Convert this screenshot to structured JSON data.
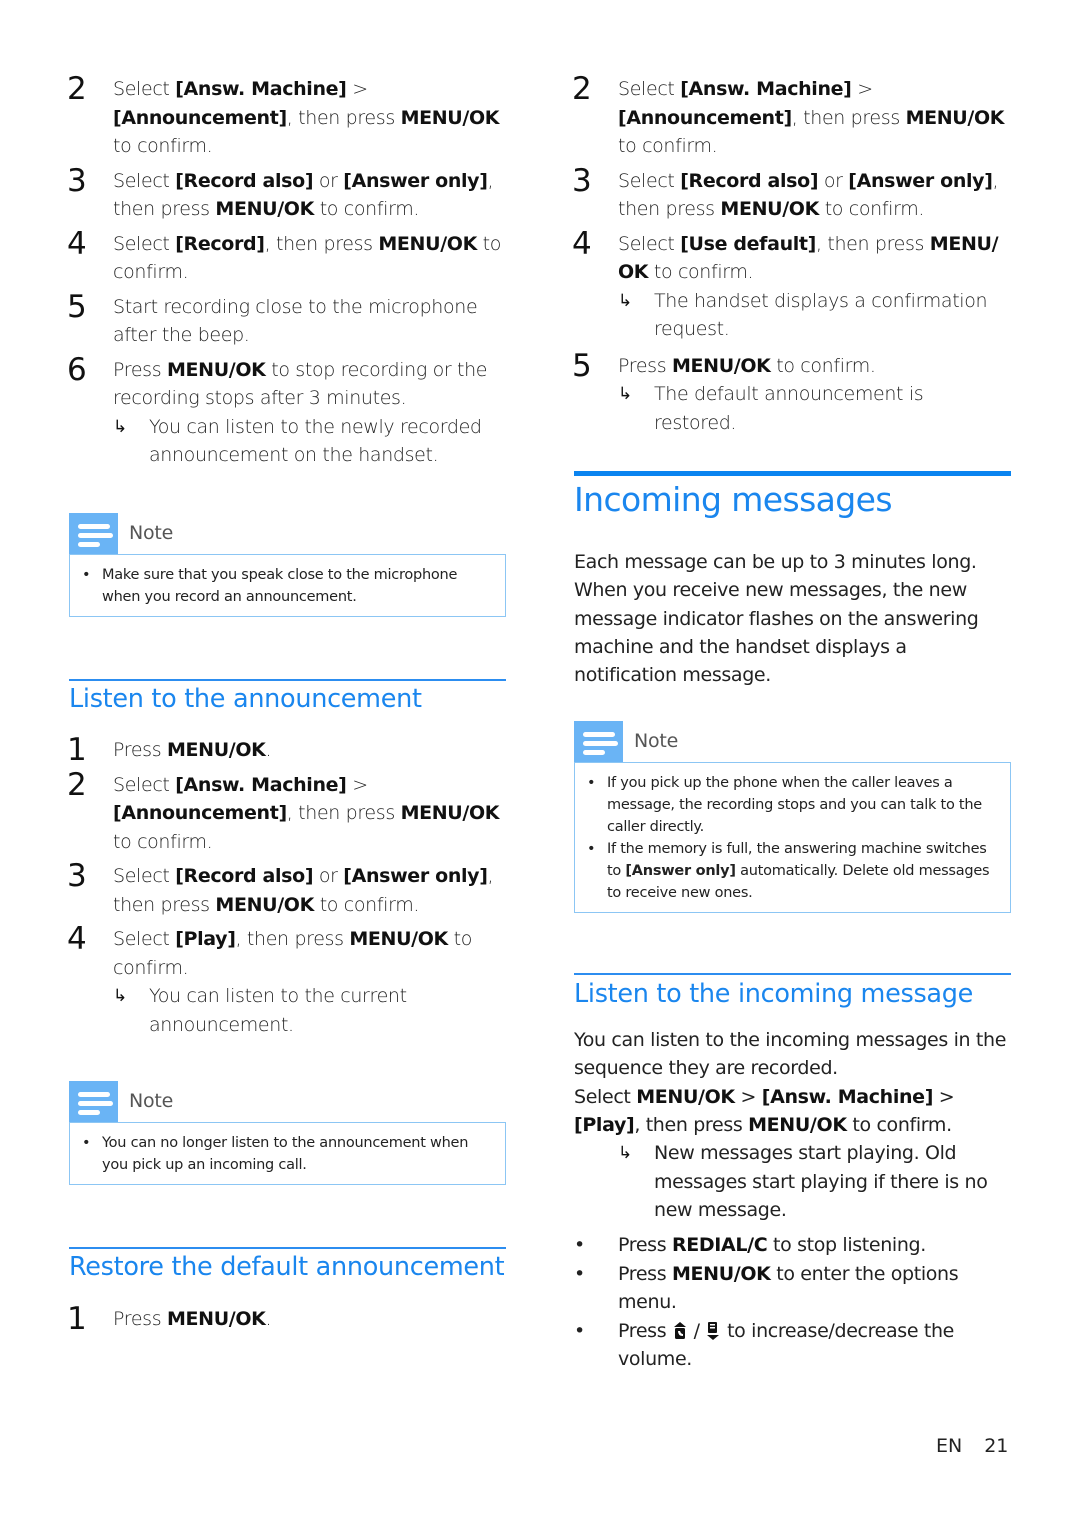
{
  "accent_color": "#1a86ee",
  "note_color": "#6ab4f5",
  "left": {
    "record_steps": [
      {
        "num": "2",
        "parts": [
          [
            "t",
            "Select "
          ],
          [
            "b",
            "[Answ. Machine]"
          ],
          [
            "t",
            " > "
          ],
          [
            "b",
            "[Announcement]"
          ],
          [
            "t",
            ", then press "
          ],
          [
            "b",
            "MENU/OK"
          ],
          [
            "t",
            " to confirm."
          ]
        ]
      },
      {
        "num": "3",
        "parts": [
          [
            "t",
            "Select "
          ],
          [
            "b",
            "[Record also]"
          ],
          [
            "t",
            " or "
          ],
          [
            "b",
            "[Answer only]"
          ],
          [
            "t",
            ", then press "
          ],
          [
            "b",
            "MENU/OK"
          ],
          [
            "t",
            " to confirm."
          ]
        ]
      },
      {
        "num": "4",
        "parts": [
          [
            "t",
            "Select "
          ],
          [
            "b",
            "[Record]"
          ],
          [
            "t",
            ", then press "
          ],
          [
            "b",
            "MENU/OK"
          ],
          [
            "t",
            " to confirm."
          ]
        ]
      },
      {
        "num": "5",
        "parts": [
          [
            "t",
            "Start recording close to the microphone after the beep."
          ]
        ]
      },
      {
        "num": "6",
        "parts": [
          [
            "t",
            "Press "
          ],
          [
            "b",
            "MENU/OK"
          ],
          [
            "t",
            " to stop recording or the recording stops after 3 minutes."
          ]
        ],
        "result": "You can listen to the newly recorded announcement on the handset."
      }
    ],
    "note1": {
      "label": "Note",
      "items": [
        [
          [
            "t",
            "Make sure that you speak close to the microphone when you record an announcement."
          ]
        ]
      ]
    },
    "listen_heading": "Listen to the announcement",
    "listen_steps": [
      {
        "num": "1",
        "parts": [
          [
            "t",
            "Press "
          ],
          [
            "b",
            "MENU/OK"
          ],
          [
            "t",
            "."
          ]
        ]
      },
      {
        "num": "2",
        "parts": [
          [
            "t",
            "Select "
          ],
          [
            "b",
            "[Answ. Machine]"
          ],
          [
            "t",
            " > "
          ],
          [
            "b",
            "[Announcement]"
          ],
          [
            "t",
            ", then press "
          ],
          [
            "b",
            "MENU/OK"
          ],
          [
            "t",
            " to confirm."
          ]
        ]
      },
      {
        "num": "3",
        "parts": [
          [
            "t",
            "Select "
          ],
          [
            "b",
            "[Record also]"
          ],
          [
            "t",
            " or "
          ],
          [
            "b",
            "[Answer only]"
          ],
          [
            "t",
            ", then press "
          ],
          [
            "b",
            "MENU/OK"
          ],
          [
            "t",
            " to confirm."
          ]
        ]
      },
      {
        "num": "4",
        "parts": [
          [
            "t",
            "Select "
          ],
          [
            "b",
            "[Play]"
          ],
          [
            "t",
            ", then press "
          ],
          [
            "b",
            "MENU/OK"
          ],
          [
            "t",
            " to confirm."
          ]
        ],
        "result": "You can listen to the current announcement."
      }
    ],
    "note2": {
      "label": "Note",
      "items": [
        [
          [
            "t",
            "You can no longer listen to the announcement when you pick up an incoming call."
          ]
        ]
      ]
    },
    "restore_heading": "Restore the default announcement",
    "restore_steps": [
      {
        "num": "1",
        "parts": [
          [
            "t",
            "Press "
          ],
          [
            "b",
            "MENU/OK"
          ],
          [
            "t",
            "."
          ]
        ]
      }
    ]
  },
  "right": {
    "restore_steps": [
      {
        "num": "2",
        "parts": [
          [
            "t",
            "Select "
          ],
          [
            "b",
            "[Answ. Machine]"
          ],
          [
            "t",
            " > "
          ],
          [
            "b",
            "[Announcement]"
          ],
          [
            "t",
            ", then press "
          ],
          [
            "b",
            "MENU/OK"
          ],
          [
            "t",
            " to confirm."
          ]
        ]
      },
      {
        "num": "3",
        "parts": [
          [
            "t",
            "Select "
          ],
          [
            "b",
            "[Record also]"
          ],
          [
            "t",
            " or "
          ],
          [
            "b",
            "[Answer only]"
          ],
          [
            "t",
            ", then press "
          ],
          [
            "b",
            "MENU/OK"
          ],
          [
            "t",
            " to confirm."
          ]
        ]
      },
      {
        "num": "4",
        "parts": [
          [
            "t",
            "Select "
          ],
          [
            "b",
            "[Use default]"
          ],
          [
            "t",
            ", then press "
          ],
          [
            "b",
            "MENU/ OK"
          ],
          [
            "t",
            " to confirm."
          ]
        ],
        "result": "The handset displays a confirmation request."
      },
      {
        "num": "5",
        "parts": [
          [
            "t",
            "Press "
          ],
          [
            "b",
            "MENU/OK"
          ],
          [
            "t",
            " to confirm."
          ]
        ],
        "result": "The default announcement is restored."
      }
    ],
    "incoming_heading": "Incoming messages",
    "incoming_intro": "Each message can be up to 3 minutes long. When you receive new messages, the new message indicator flashes on the answering machine and the handset displays a notification message.",
    "note3": {
      "label": "Note",
      "items": [
        [
          [
            "t",
            "If you pick up the phone when the caller leaves a message, the recording stops and you can talk to the caller directly."
          ]
        ],
        [
          [
            "t",
            "If the memory is full, the answering machine switches to "
          ],
          [
            "b",
            "[Answer only]"
          ],
          [
            "t",
            " automatically. Delete old messages to receive new ones."
          ]
        ]
      ]
    },
    "listen_msg_heading": "Listen to the incoming message",
    "listen_msg_intro": "You can listen to the incoming messages in the sequence they are recorded.",
    "listen_msg_select": [
      [
        "t",
        "Select "
      ],
      [
        "b",
        "MENU/OK"
      ],
      [
        "t",
        " > "
      ],
      [
        "b",
        "[Answ. Machine]"
      ],
      [
        "t",
        " > "
      ],
      [
        "b",
        "[Play]"
      ],
      [
        "t",
        ", then press "
      ],
      [
        "b",
        "MENU/OK"
      ],
      [
        "t",
        " to confirm."
      ]
    ],
    "listen_msg_result": "New messages start playing. Old messages start playing if there is no new message.",
    "options": [
      {
        "parts": [
          [
            "t",
            "Press "
          ],
          [
            "b",
            "REDIAL/C"
          ],
          [
            "t",
            " to stop listening."
          ]
        ]
      },
      {
        "parts": [
          [
            "t",
            "Press "
          ],
          [
            "b",
            "MENU/OK"
          ],
          [
            "t",
            " to enter the options menu."
          ]
        ]
      },
      {
        "parts": [
          [
            "t",
            "Press "
          ],
          [
            "i",
            "volume-up-key-icon"
          ],
          [
            "t",
            " / "
          ],
          [
            "i",
            "volume-down-key-icon"
          ],
          [
            "t",
            " to increase/decrease the volume."
          ]
        ]
      }
    ]
  },
  "footer": {
    "lang": "EN",
    "page": "21"
  }
}
